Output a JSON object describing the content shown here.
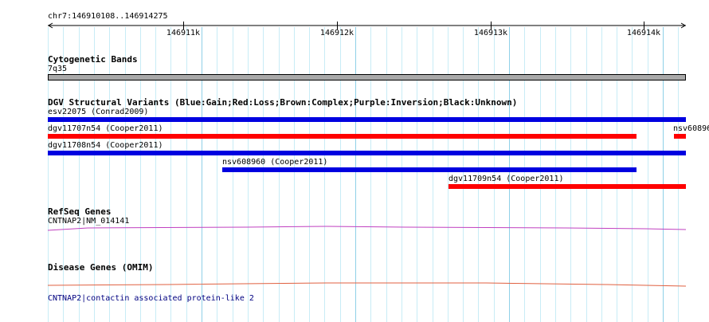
{
  "ruler": {
    "label": "chr7:146910108..146914275",
    "ticks": [
      "146911k",
      "146912k",
      "146913k",
      "146914k"
    ]
  },
  "tracks": {
    "cytoband": {
      "title": "Cytogenetic Bands",
      "band_label": "7q35",
      "band_color": "#a9a9a9"
    },
    "dgv": {
      "title": "DGV Structural Variants (Blue:Gain;Red:Loss;Brown:Complex;Purple:Inversion;Black:Unknown)",
      "features": [
        {
          "label": "esv22075 (Conrad2009)",
          "color": "#0000e0"
        },
        {
          "label": "dgv11707n54 (Cooper2011)",
          "color": "#ff0000"
        },
        {
          "label": "nsv60896",
          "color": "#ff0000"
        },
        {
          "label": "dgv11708n54 (Cooper2011)",
          "color": "#0000e0"
        },
        {
          "label": "nsv608960 (Cooper2011)",
          "color": "#0000e0"
        },
        {
          "label": "dgv11709n54 (Cooper2011)",
          "color": "#ff0000"
        }
      ]
    },
    "refseq": {
      "title": "RefSeq Genes",
      "gene_label": "CNTNAP2|NM_014141",
      "line_color": "#c040c0"
    },
    "omim": {
      "title": "Disease Genes (OMIM)",
      "line_color": "#e06040",
      "link_text": "CNTNAP2|contactin associated protein-like 2",
      "link_color": "#000080"
    }
  }
}
